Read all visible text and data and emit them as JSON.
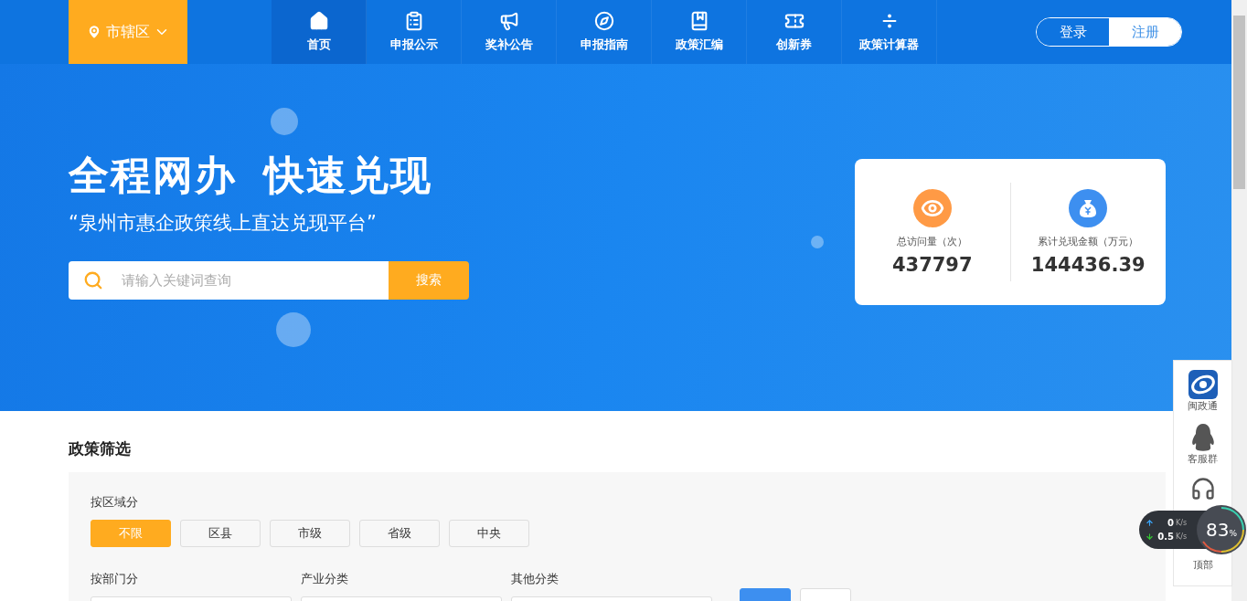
{
  "header": {
    "location": "市辖区",
    "nav": [
      {
        "label": "首页",
        "selected": true,
        "kind": "home"
      },
      {
        "label": "申报公示",
        "selected": false,
        "kind": "board"
      },
      {
        "label": "奖补公告",
        "selected": false,
        "kind": "megaphone"
      },
      {
        "label": "申报指南",
        "selected": false,
        "kind": "compass"
      },
      {
        "label": "政策汇编",
        "selected": false,
        "kind": "book"
      },
      {
        "label": "创新券",
        "selected": false,
        "kind": "ticket"
      },
      {
        "label": "政策计算器",
        "selected": false,
        "kind": "calculator"
      }
    ],
    "login": "登录",
    "register": "注册"
  },
  "hero": {
    "title": [
      "全程网办",
      "快速兑现"
    ],
    "subtitle": "“泉州市惠企政策线上直达兑现平台”",
    "search": {
      "placeholder": "请输入关键词查询",
      "button": "搜索"
    },
    "stats": [
      {
        "label": "总访问量（次）",
        "value": "437797",
        "kind": "visits"
      },
      {
        "label": "累计兑现金额（万元）",
        "value": "144436.39",
        "kind": "money"
      }
    ]
  },
  "filter": {
    "title": "政策筛选",
    "region": {
      "label": "按区域分",
      "options": [
        {
          "label": "不限",
          "selected": true
        },
        {
          "label": "区县",
          "selected": false
        },
        {
          "label": "市级",
          "selected": false
        },
        {
          "label": "省级",
          "selected": false
        },
        {
          "label": "中央",
          "selected": false
        }
      ]
    },
    "dropdowns": [
      {
        "label": "按部门分"
      },
      {
        "label": "产业分类"
      },
      {
        "label": "其他分类"
      }
    ]
  },
  "side_tools": [
    {
      "label": "闽政通",
      "kind": "app"
    },
    {
      "label": "客服群",
      "kind": "penguin"
    },
    {
      "kind": "headset"
    },
    {
      "label": "顶部",
      "kind": "top"
    }
  ],
  "speed_widget": {
    "upload": "0",
    "upload_unit": "K/s",
    "download": "0.5",
    "download_unit": "K/s",
    "percent": "83",
    "percent_sign": "%"
  }
}
